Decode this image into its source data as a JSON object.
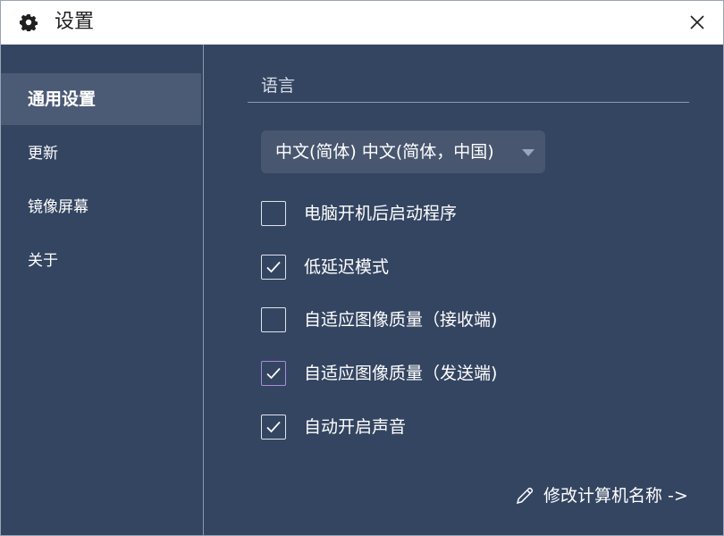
{
  "window": {
    "title": "设置"
  },
  "sidebar": {
    "items": [
      {
        "label": "通用设置",
        "active": true
      },
      {
        "label": "更新"
      },
      {
        "label": "镜像屏幕"
      },
      {
        "label": "关于"
      }
    ]
  },
  "general": {
    "language_title": "语言",
    "language_value": "中文(简体) 中文(简体，中国)",
    "options": [
      {
        "label": "电脑开机后启动程序",
        "checked": false
      },
      {
        "label": "低延迟模式",
        "checked": true
      },
      {
        "label": "自适应图像质量（接收端)",
        "checked": false
      },
      {
        "label": "自适应图像质量（发送端)",
        "checked": true
      },
      {
        "label": "自动开启声音",
        "checked": true
      }
    ],
    "rename_link": "修改计算机名称 ->"
  },
  "colors": {
    "accent_purple": "#a98bd8",
    "panel": "#344561",
    "active_item": "#4b5a75"
  }
}
